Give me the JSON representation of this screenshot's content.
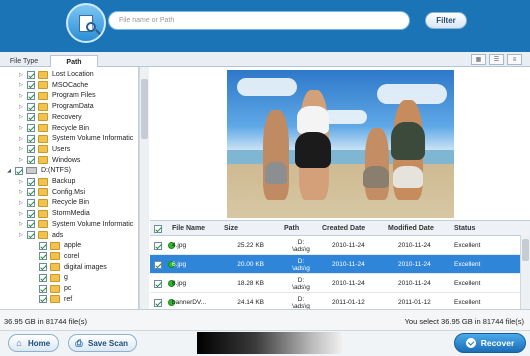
{
  "header": {
    "search_placeholder": "File name or Path",
    "filter_label": "Filter"
  },
  "tabs": [
    {
      "label": "File Type",
      "active": false
    },
    {
      "label": "Path",
      "active": true
    }
  ],
  "view_modes": [
    "thumbnail-view-icon",
    "list-view-icon",
    "detail-view-icon"
  ],
  "tree": {
    "items": [
      {
        "label": "Lost Location",
        "checked": true,
        "icon": "folder-icon",
        "level": 1
      },
      {
        "label": "MSOCache",
        "checked": true,
        "icon": "folder-icon",
        "level": 1
      },
      {
        "label": "Program Files",
        "checked": true,
        "icon": "folder-icon",
        "level": 1
      },
      {
        "label": "ProgramData",
        "checked": true,
        "icon": "folder-icon",
        "level": 1
      },
      {
        "label": "Recovery",
        "checked": true,
        "icon": "folder-icon",
        "level": 1
      },
      {
        "label": "Recycle Bin",
        "checked": true,
        "icon": "folder-icon",
        "level": 1
      },
      {
        "label": "System Volume Informatic",
        "checked": true,
        "icon": "folder-icon",
        "level": 1
      },
      {
        "label": "Users",
        "checked": true,
        "icon": "folder-icon",
        "level": 1
      },
      {
        "label": "Windows",
        "checked": true,
        "icon": "folder-icon",
        "level": 1
      },
      {
        "label": "D:(NTFS)",
        "checked": true,
        "icon": "drive-icon",
        "level": 0
      },
      {
        "label": "Backup",
        "checked": true,
        "icon": "folder-icon",
        "level": 1
      },
      {
        "label": "Config.Msi",
        "checked": true,
        "icon": "folder-icon",
        "level": 1
      },
      {
        "label": "Recycle Bin",
        "checked": true,
        "icon": "folder-icon",
        "level": 1
      },
      {
        "label": "StormMedia",
        "checked": true,
        "icon": "folder-icon",
        "level": 1
      },
      {
        "label": "System Volume Informatic",
        "checked": true,
        "icon": "folder-icon",
        "level": 1
      },
      {
        "label": "ads",
        "checked": true,
        "icon": "folder-icon",
        "level": 1
      },
      {
        "label": "apple",
        "checked": true,
        "icon": "folder-icon",
        "level": 2
      },
      {
        "label": "corel",
        "checked": true,
        "icon": "folder-icon",
        "level": 2
      },
      {
        "label": "digital images",
        "checked": true,
        "icon": "folder-icon",
        "level": 2
      },
      {
        "label": "g",
        "checked": true,
        "icon": "folder-icon",
        "level": 2
      },
      {
        "label": "pc",
        "checked": true,
        "icon": "folder-icon",
        "level": 2
      },
      {
        "label": "ref",
        "checked": true,
        "icon": "folder-icon",
        "level": 2
      }
    ]
  },
  "table": {
    "columns": [
      "File Name",
      "Size",
      "Path",
      "Created Date",
      "Modified Date",
      "Status"
    ],
    "rows": [
      {
        "name": "4.jpg",
        "size": "25.22 KB",
        "path1": "D:",
        "path2": "\\ads\\g",
        "created": "2010-11-24",
        "modified": "2010-11-24",
        "status": "Excellent",
        "selected": false
      },
      {
        "name": "6.jpg",
        "size": "20.00 KB",
        "path1": "D:",
        "path2": "\\ads\\g",
        "created": "2010-11-24",
        "modified": "2010-11-24",
        "status": "Excellent",
        "selected": true
      },
      {
        "name": "8.jpg",
        "size": "18.28 KB",
        "path1": "D:",
        "path2": "\\ads\\g",
        "created": "2010-11-24",
        "modified": "2010-11-24",
        "status": "Excellent",
        "selected": false
      },
      {
        "name": "bannerDV...",
        "size": "24.14 KB",
        "path1": "D:",
        "path2": "\\ads\\g",
        "created": "2011-01-12",
        "modified": "2011-01-12",
        "status": "Excellent",
        "selected": false
      }
    ]
  },
  "status_bar": {
    "left": "36.95 GB in 81744 file(s)",
    "right": "You select 36.95 GB in 81744 file(s)"
  },
  "bottom": {
    "home_label": "Home",
    "save_scan_label": "Save Scan",
    "recover_label": "Recover"
  },
  "colors": {
    "header": "#1a74b5",
    "selection": "#2f86d9",
    "status_ok": "#2dbb2d"
  }
}
